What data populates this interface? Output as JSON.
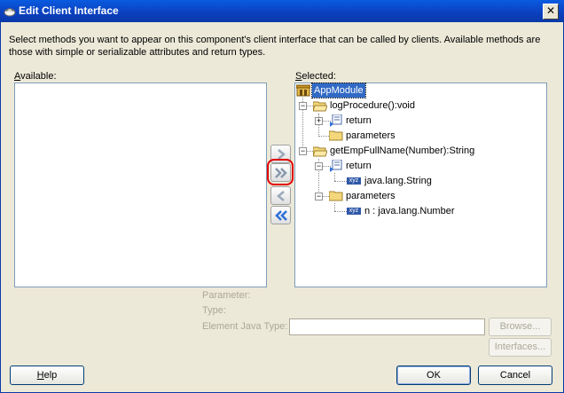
{
  "window": {
    "title": "Edit Client Interface",
    "close_glyph": "✕"
  },
  "description": "Select methods you want to appear on this component's client interface that can be called by clients.  Available methods are those with simple or serializable attributes and return types.",
  "available": {
    "label_mnemonic": "A",
    "label_rest": "vailable:"
  },
  "selected": {
    "label_mnemonic": "S",
    "label_rest": "elected:",
    "root": "AppModule",
    "m1": {
      "name": "logProcedure():void",
      "return": "return",
      "parameters": "parameters"
    },
    "m2": {
      "name": "getEmpFullName(Number):String",
      "return": "return",
      "return_type": "java.lang.String",
      "parameters": "parameters",
      "param": "n : java.lang.Number"
    }
  },
  "details": {
    "parameter_label": "Parameter:",
    "type_label": "Type:",
    "element_java_type_label": "Element Java Type:",
    "browse_label": "Browse...",
    "interfaces_label": "Interfaces..."
  },
  "buttons": {
    "help_mnemonic": "H",
    "help_rest": "elp",
    "ok": "OK",
    "cancel": "Cancel"
  },
  "icons": {
    "expanded": "−",
    "collapsed": "+",
    "type_badge": "xyz"
  }
}
